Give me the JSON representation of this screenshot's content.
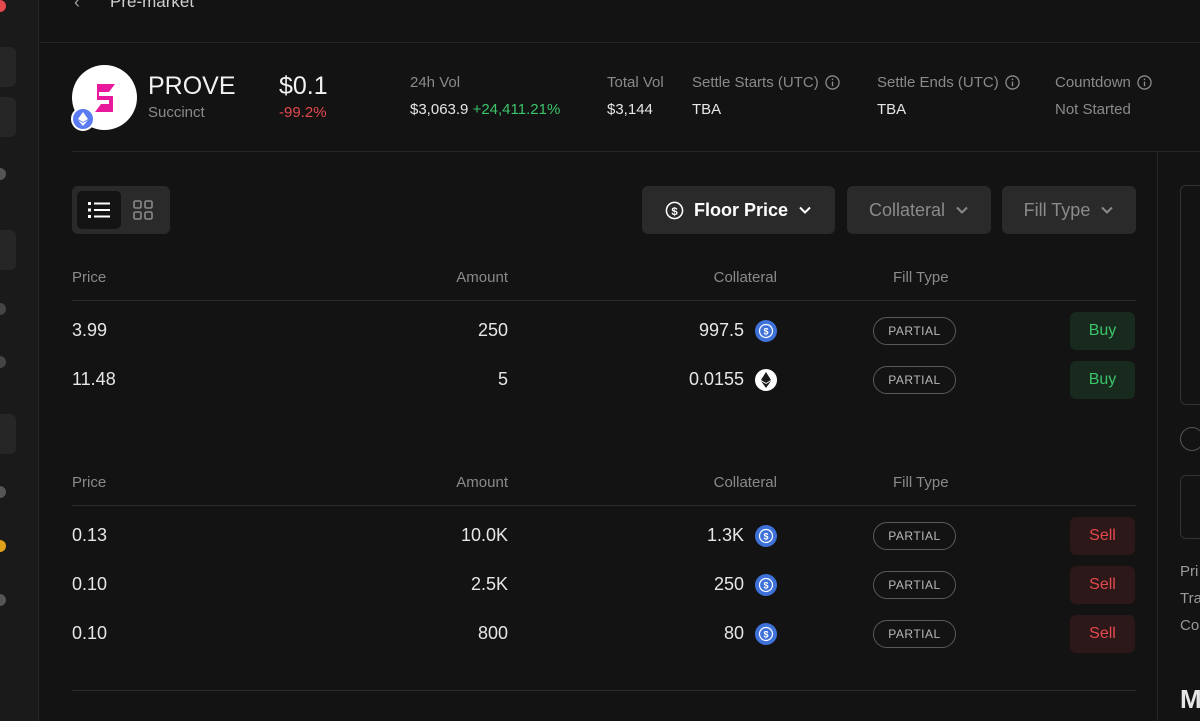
{
  "topbar": {
    "back_glyph": "‹",
    "title": "Pre-market"
  },
  "token": {
    "symbol": "PROVE",
    "name": "Succinct",
    "price": "$0.1",
    "change": "-99.2%",
    "logo_color": "#e8199b",
    "chain_icon": "ethereum-icon"
  },
  "stats": {
    "vol24h_label": "24h Vol",
    "vol24h_value": "$3,063.9",
    "vol24h_change": "+24,411.21%",
    "total_vol_label": "Total Vol",
    "total_vol_value": "$3,144",
    "settle_start_label": "Settle Starts (UTC)",
    "settle_start_value": "TBA",
    "settle_end_label": "Settle Ends (UTC)",
    "settle_end_value": "TBA",
    "countdown_label": "Countdown",
    "countdown_value": "Not Started"
  },
  "filters": {
    "floor_price": "Floor Price",
    "collateral": "Collateral",
    "fill_type": "Fill Type"
  },
  "table_headers": {
    "price": "Price",
    "amount": "Amount",
    "collateral": "Collateral",
    "fill_type": "Fill Type"
  },
  "buy_orders": [
    {
      "price": "3.99",
      "amount": "250",
      "collateral": "997.5",
      "coin": "usdc",
      "fill": "PARTIAL",
      "action": "Buy"
    },
    {
      "price": "11.48",
      "amount": "5",
      "collateral": "0.0155",
      "coin": "eth",
      "fill": "PARTIAL",
      "action": "Buy"
    }
  ],
  "sell_orders": [
    {
      "price": "0.13",
      "amount": "10.0K",
      "collateral": "1.3K",
      "coin": "usdc",
      "fill": "PARTIAL",
      "action": "Sell"
    },
    {
      "price": "0.10",
      "amount": "2.5K",
      "collateral": "250",
      "coin": "usdc",
      "fill": "PARTIAL",
      "action": "Sell"
    },
    {
      "price": "0.10",
      "amount": "800",
      "collateral": "80",
      "coin": "usdc",
      "fill": "PARTIAL",
      "action": "Sell"
    }
  ],
  "right_panel": {
    "line1": "Pri",
    "line2": "Tra",
    "line3": "Co",
    "heading": "M"
  },
  "colors": {
    "positive": "#3bc46a",
    "negative": "#e5484d",
    "usdc": "#3f72d9",
    "background": "#131313"
  }
}
